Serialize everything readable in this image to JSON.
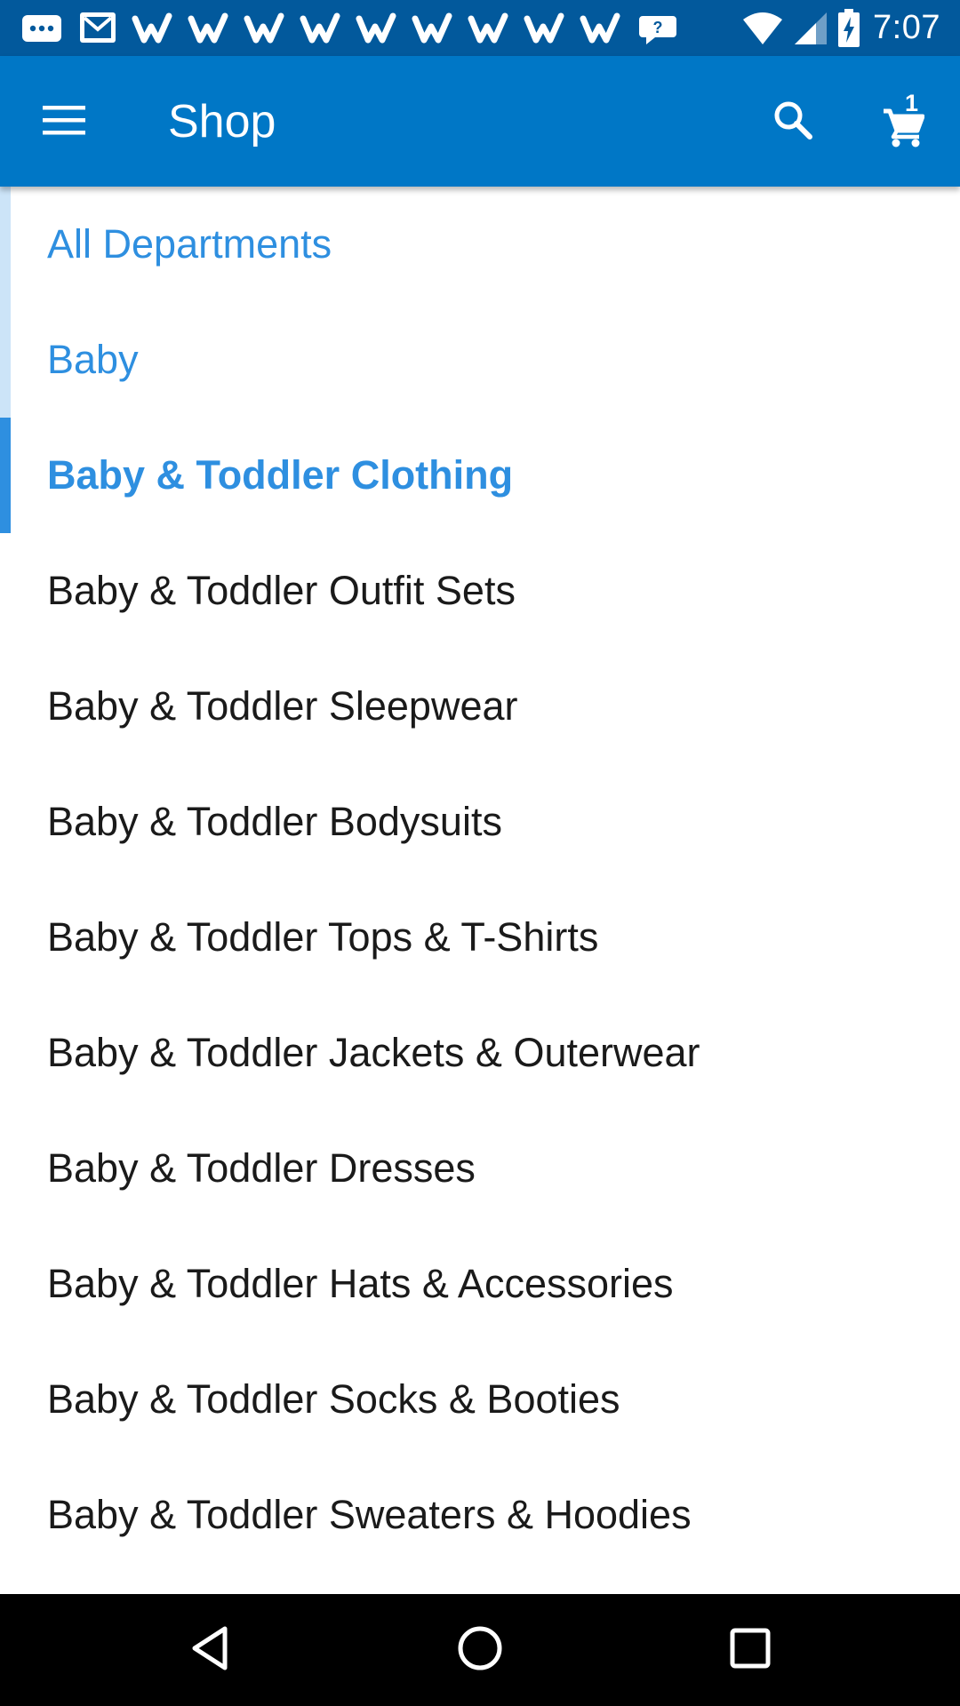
{
  "status_bar": {
    "time": "7:07",
    "notification_icons": [
      "messages-icon",
      "gmail-icon",
      "walmart-icon",
      "walmart-icon",
      "walmart-icon",
      "walmart-icon",
      "walmart-icon",
      "walmart-icon",
      "walmart-icon",
      "walmart-icon",
      "walmart-icon",
      "chat-bubble-icon"
    ],
    "system_icons": [
      "wifi-icon",
      "cell-signal-icon",
      "battery-charging-icon"
    ]
  },
  "app_bar": {
    "title": "Shop",
    "cart_count": "1",
    "icons": {
      "menu": "hamburger-menu-icon",
      "search": "search-icon",
      "cart": "shopping-cart-icon"
    }
  },
  "departments": {
    "breadcrumbs": [
      "All Departments",
      "Baby"
    ],
    "current": "Baby & Toddler Clothing",
    "items": [
      "Baby & Toddler Outfit Sets",
      "Baby & Toddler Sleepwear",
      "Baby & Toddler Bodysuits",
      "Baby & Toddler Tops & T-Shirts",
      "Baby & Toddler Jackets & Outerwear",
      "Baby & Toddler Dresses",
      "Baby & Toddler Hats & Accessories",
      "Baby & Toddler Socks & Booties",
      "Baby & Toddler Sweaters & Hoodies"
    ]
  },
  "nav_bar": {
    "icons": [
      "back-icon",
      "home-icon",
      "recents-icon"
    ]
  },
  "colors": {
    "status_bar": "#02599c",
    "app_bar": "#0077c6",
    "accent": "#2e8fe0",
    "crumb_stripe": "#cce4f8",
    "nav_bar": "#000000"
  }
}
